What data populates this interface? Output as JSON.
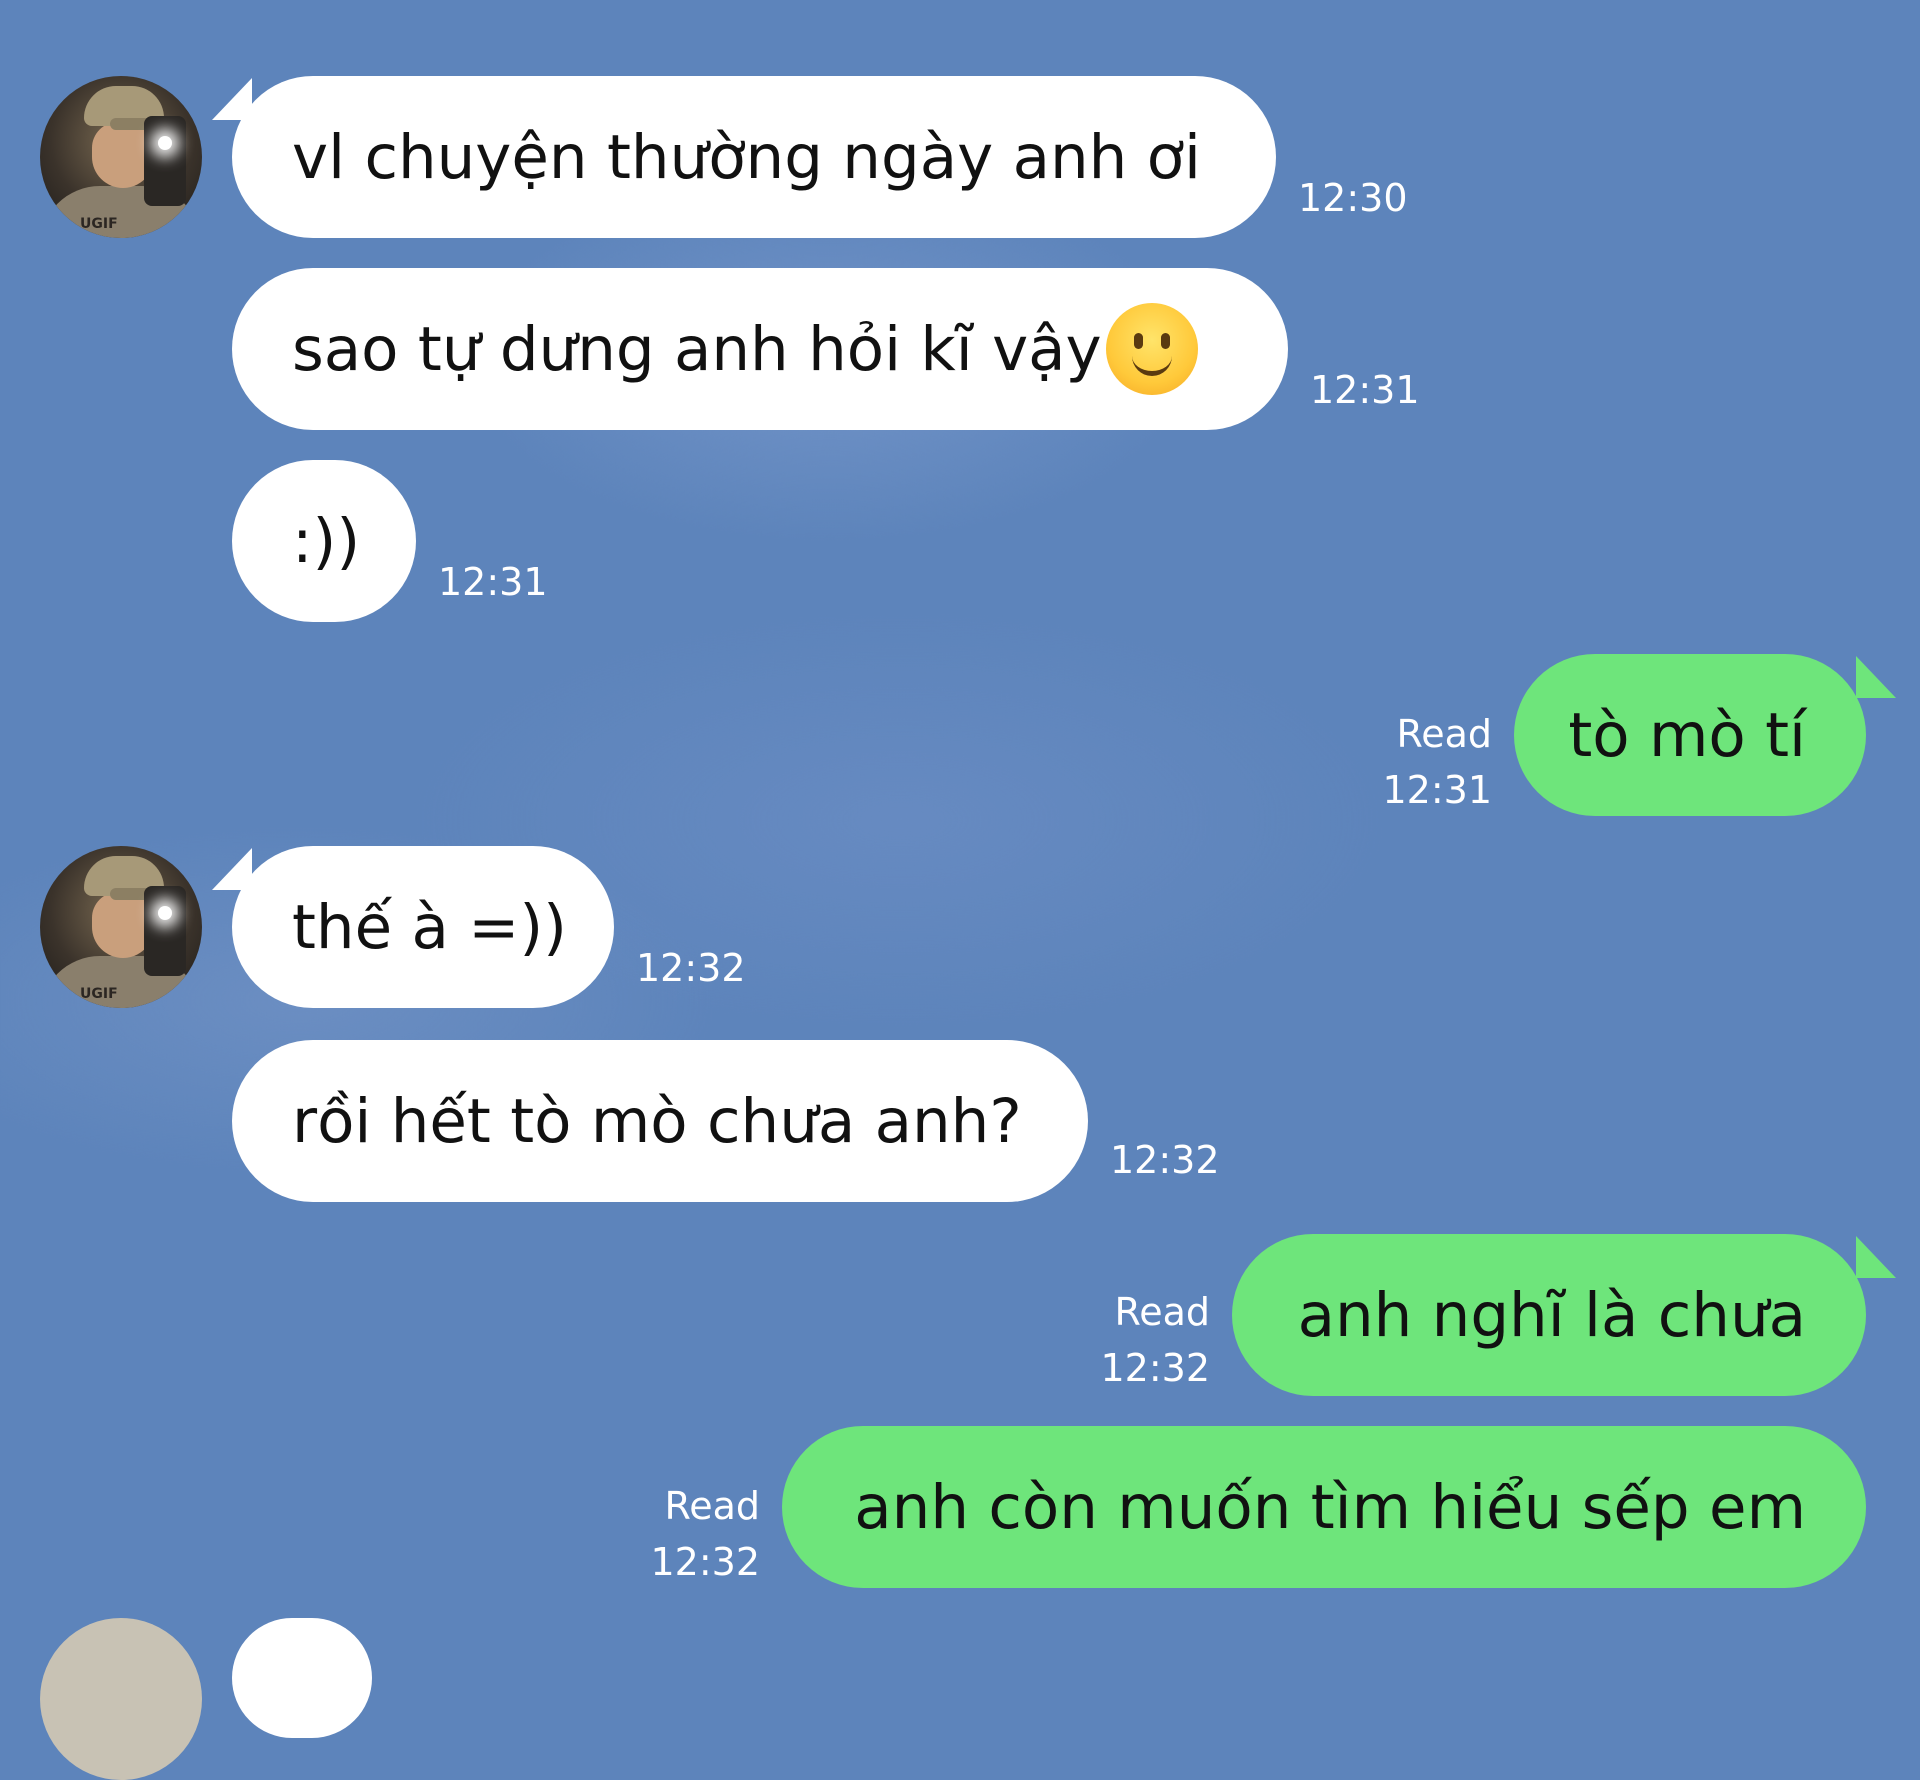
{
  "messages": [
    {
      "direction": "in",
      "text": "vl chuyện thường ngày anh ơi",
      "time": "12:30",
      "avatar": true
    },
    {
      "direction": "in",
      "text": "sao tự dưng anh hỏi kĩ vậy",
      "emoji": "slightly-smiling-face",
      "time": "12:31",
      "avatar": false
    },
    {
      "direction": "in",
      "text": ":))",
      "time": "12:31",
      "avatar": false
    },
    {
      "direction": "out",
      "text": "tò mò tí",
      "status": "Read",
      "time": "12:31"
    },
    {
      "direction": "in",
      "text": "thế à =))",
      "time": "12:32",
      "avatar": true
    },
    {
      "direction": "in",
      "text": "rồi hết tò mò chưa anh?",
      "time": "12:32",
      "avatar": false
    },
    {
      "direction": "out",
      "text": "anh nghĩ là chưa",
      "status": "Read",
      "time": "12:32"
    },
    {
      "direction": "out",
      "text": "anh còn muốn tìm hiểu sếp em",
      "status": "Read",
      "time": "12:32"
    }
  ],
  "avatar_logo": "UGIF",
  "colors": {
    "background": "#5d84bb",
    "incoming_bubble": "#ffffff",
    "outgoing_bubble": "#6ee57b",
    "meta_text": "#ffffff"
  }
}
